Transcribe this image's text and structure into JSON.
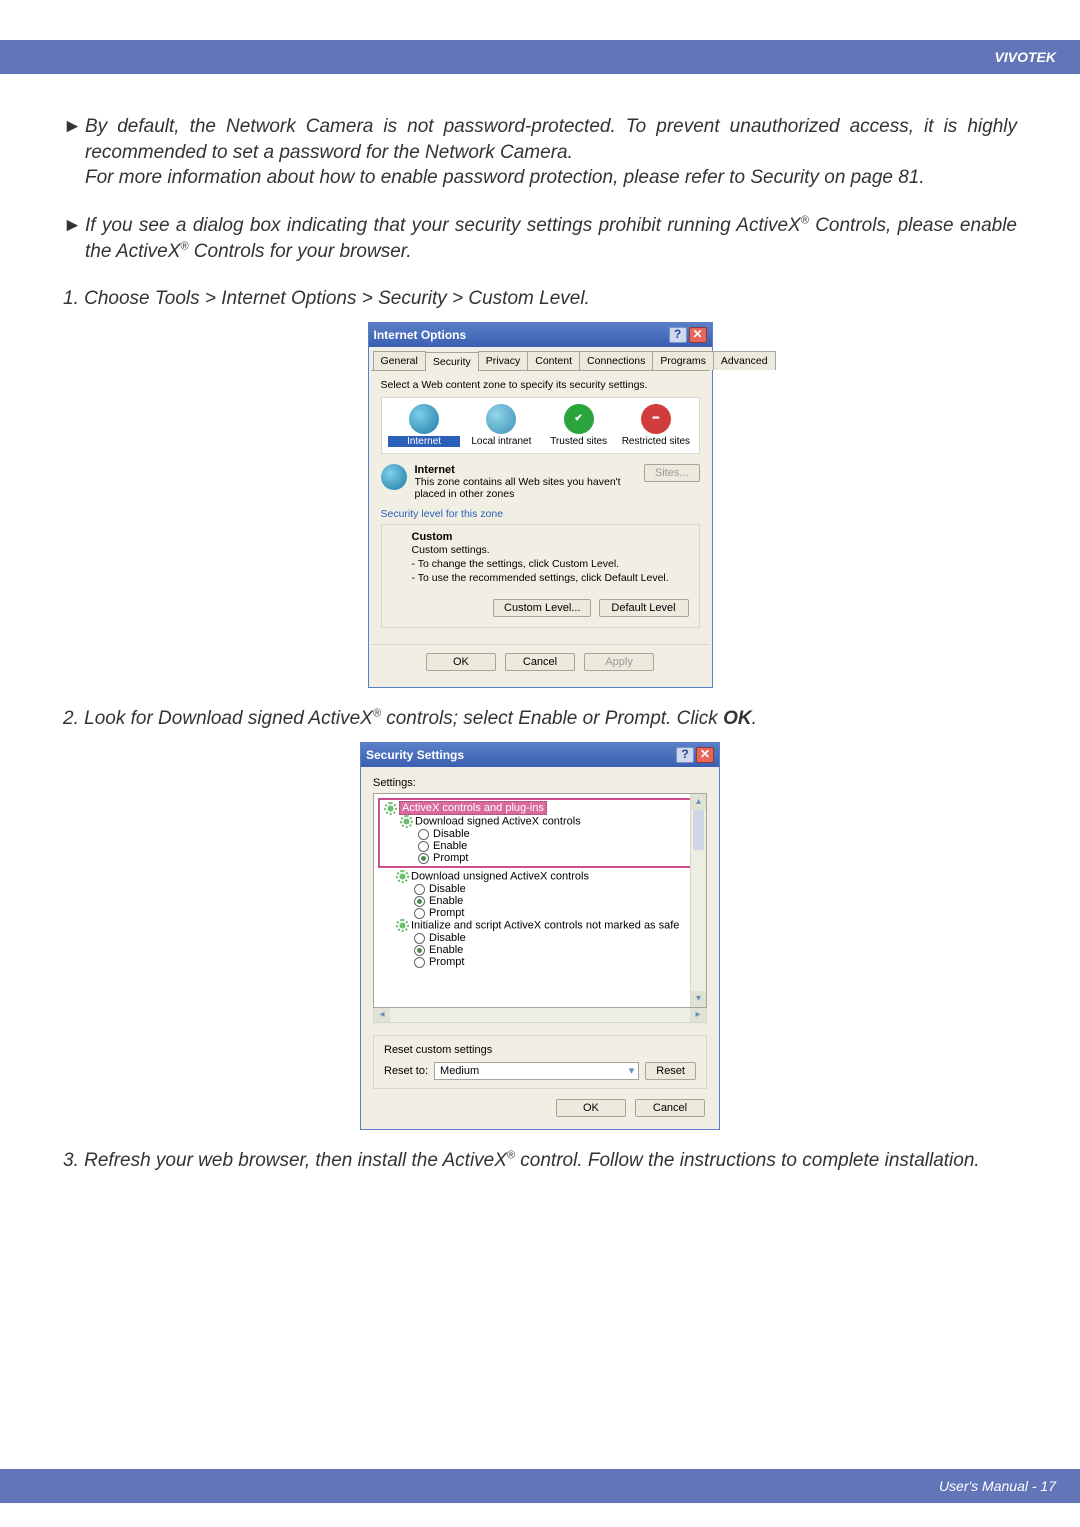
{
  "brand": "VIVOTEK",
  "para1": "By default, the Network Camera is not password-protected. To prevent unauthorized access, it is highly recommended to set a password for the Network Camera.",
  "para1b": "For more information about how to enable password protection, please refer to Security on page 81.",
  "para2a": "If you see a dialog box indicating that your security settings prohibit running ActiveX",
  "para2b": " Controls, please enable the ActiveX",
  "para2c": " Controls for your browser.",
  "step1": "1. Choose Tools > Internet Options > Security > Custom Level.",
  "step2a": "2. Look for Download signed ActiveX",
  "step2b": " controls; select Enable or Prompt. Click ",
  "step2ok": "OK",
  "step3a": "3. Refresh your web browser, then install the ActiveX",
  "step3b": " control. Follow the instructions to complete installation.",
  "footer": "User's Manual - 17",
  "io": {
    "title": "Internet Options",
    "tabs": [
      "General",
      "Security",
      "Privacy",
      "Content",
      "Connections",
      "Programs",
      "Advanced"
    ],
    "zone_prompt": "Select a Web content zone to specify its security settings.",
    "zones": {
      "internet": "Internet",
      "intranet": "Local intranet",
      "trusted": "Trusted sites",
      "restricted": "Restricted sites"
    },
    "zone_title": "Internet",
    "zone_desc": "This zone contains all Web sites you haven't placed in other zones",
    "sites": "Sites...",
    "sec_level_label": "Security level for this zone",
    "custom": "Custom",
    "custom_sub": "Custom settings.",
    "custom_l1": "- To change the settings, click Custom Level.",
    "custom_l2": "- To use the recommended settings, click Default Level.",
    "btn_custom": "Custom Level...",
    "btn_default": "Default Level",
    "ok": "OK",
    "cancel": "Cancel",
    "apply": "Apply"
  },
  "ss": {
    "title": "Security Settings",
    "settings": "Settings:",
    "grp_activex": "ActiveX controls and plug-ins",
    "n_signed": "Download signed ActiveX controls",
    "n_unsigned": "Download unsigned ActiveX controls",
    "n_init": "Initialize and script ActiveX controls not marked as safe",
    "opt_disable": "Disable",
    "opt_enable": "Enable",
    "opt_prompt": "Prompt",
    "reset_label": "Reset custom settings",
    "reset_to": "Reset to:",
    "reset_val": "Medium",
    "reset": "Reset",
    "ok": "OK",
    "cancel": "Cancel"
  }
}
